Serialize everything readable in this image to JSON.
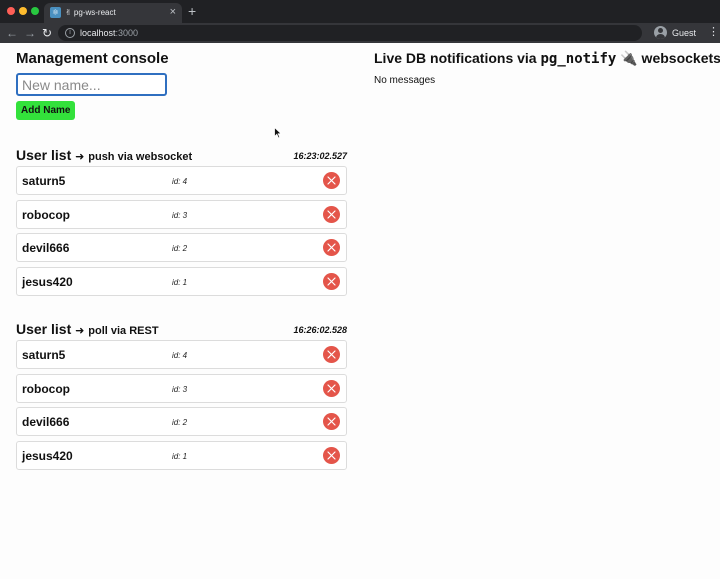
{
  "browser": {
    "tab_favicon": "⚛",
    "tab_title": "✌ pg-ws-react",
    "tab_close": "×",
    "new_tab": "+",
    "url_host": "localhost",
    "url_port": ":3000",
    "profile_name": "Guest",
    "menu": "⋮",
    "nav_back": "←",
    "nav_forward": "→",
    "nav_reload": "↻",
    "info_icon": "i"
  },
  "console": {
    "title": "Management console",
    "input_placeholder": "New name...",
    "add_button_label": "Add Name"
  },
  "push_section": {
    "title": "User list",
    "arrow": "➜",
    "subtitle": "push via websocket",
    "timestamp": "16:23:02.527",
    "users": [
      {
        "name": "saturn5",
        "id_label": "id: 4"
      },
      {
        "name": "robocop",
        "id_label": "id: 3"
      },
      {
        "name": "devil666",
        "id_label": "id: 2"
      },
      {
        "name": "jesus420",
        "id_label": "id: 1"
      }
    ]
  },
  "poll_section": {
    "title": "User list",
    "arrow": "➜",
    "subtitle": "poll via REST",
    "timestamp": "16:26:02.528",
    "users": [
      {
        "name": "saturn5",
        "id_label": "id: 4"
      },
      {
        "name": "robocop",
        "id_label": "id: 3"
      },
      {
        "name": "devil666",
        "id_label": "id: 2"
      },
      {
        "name": "jesus420",
        "id_label": "id: 1"
      }
    ]
  },
  "live": {
    "title_prefix": "Live DB notifications via ",
    "title_code": "pg_notify",
    "title_icon": "🔌",
    "title_suffix": " websockets",
    "status": "No messages"
  },
  "colors": {
    "add_button": "#33e13b",
    "delete_button": "#e4554a",
    "input_focus": "#2f6fc0"
  },
  "icons": {
    "delete": "close-x-icon",
    "cursor": "mouse-pointer-icon",
    "plug": "electric-plug-icon"
  }
}
